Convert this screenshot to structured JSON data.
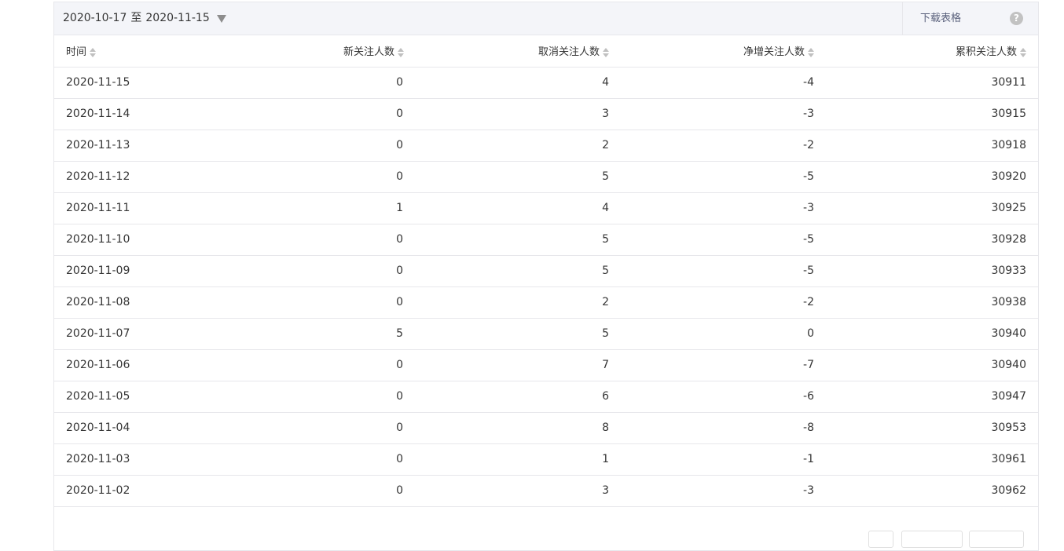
{
  "toolbar": {
    "date_start": "2020-10-17",
    "date_sep": "至",
    "date_end": "2020-11-15",
    "download_label": "下载表格",
    "help_label": "?"
  },
  "table": {
    "headers": [
      "时间",
      "新关注人数",
      "取消关注人数",
      "净增关注人数",
      "累积关注人数"
    ],
    "rows": [
      [
        "2020-11-15",
        "0",
        "4",
        "-4",
        "30911"
      ],
      [
        "2020-11-14",
        "0",
        "3",
        "-3",
        "30915"
      ],
      [
        "2020-11-13",
        "0",
        "2",
        "-2",
        "30918"
      ],
      [
        "2020-11-12",
        "0",
        "5",
        "-5",
        "30920"
      ],
      [
        "2020-11-11",
        "1",
        "4",
        "-3",
        "30925"
      ],
      [
        "2020-11-10",
        "0",
        "5",
        "-5",
        "30928"
      ],
      [
        "2020-11-09",
        "0",
        "5",
        "-5",
        "30933"
      ],
      [
        "2020-11-08",
        "0",
        "2",
        "-2",
        "30938"
      ],
      [
        "2020-11-07",
        "5",
        "5",
        "0",
        "30940"
      ],
      [
        "2020-11-06",
        "0",
        "7",
        "-7",
        "30940"
      ],
      [
        "2020-11-05",
        "0",
        "6",
        "-6",
        "30947"
      ],
      [
        "2020-11-04",
        "0",
        "8",
        "-8",
        "30953"
      ],
      [
        "2020-11-03",
        "0",
        "1",
        "-1",
        "30961"
      ],
      [
        "2020-11-02",
        "0",
        "3",
        "-3",
        "30962"
      ]
    ]
  },
  "colors": {
    "toolbar_bg": "#f4f5f9",
    "border": "#e7e7eb",
    "text": "#353535",
    "link": "#59607b"
  }
}
